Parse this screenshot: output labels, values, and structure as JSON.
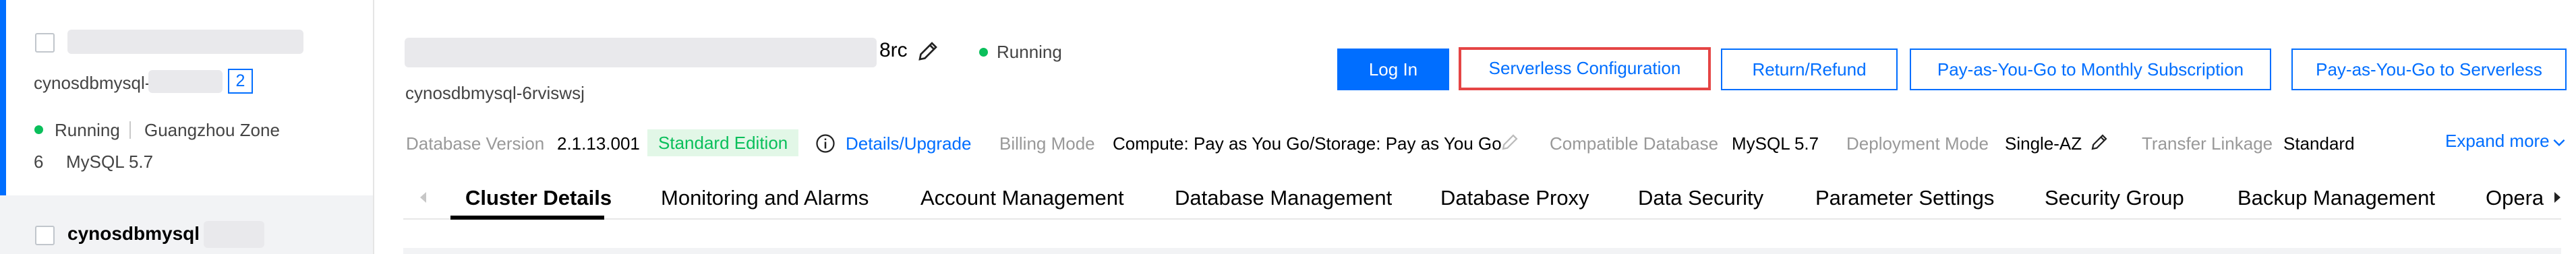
{
  "sidebar": {
    "selected_item": {
      "instance_id": "cynosdbmysql-",
      "count_badge": "2",
      "status": "Running",
      "zone": "Guangzhou Zone",
      "zone_number": "6",
      "engine": "MySQL 5.7"
    },
    "next_item": {
      "instance_id": "cynosdbmysql"
    }
  },
  "header": {
    "cluster_name_suffix": "8rc",
    "status": "Running",
    "cluster_id": "cynosdbmysql-6rviswsj",
    "buttons": {
      "login": "Log In",
      "serverless_config": "Serverless Configuration",
      "return_refund": "Return/Refund",
      "monthly": "Pay-as-You-Go to Monthly Subscription",
      "serverless": "Pay-as-You-Go to Serverless"
    }
  },
  "info": {
    "db_version_label": "Database Version",
    "db_version_value": "2.1.13.001",
    "edition": "Standard Edition",
    "details_link": "Details/Upgrade",
    "billing_label": "Billing Mode",
    "billing_value": "Compute: Pay as You Go/Storage: Pay as You Go",
    "compat_label": "Compatible Database",
    "compat_value": "MySQL 5.7",
    "deploy_label": "Deployment Mode",
    "deploy_value": "Single-AZ",
    "transfer_label": "Transfer Linkage",
    "transfer_value": "Standard",
    "expand_more": "Expand more"
  },
  "tabs": [
    {
      "label": "Cluster Details",
      "active": true
    },
    {
      "label": "Monitoring and Alarms"
    },
    {
      "label": "Account Management"
    },
    {
      "label": "Database Management"
    },
    {
      "label": "Database Proxy"
    },
    {
      "label": "Data Security"
    },
    {
      "label": "Parameter Settings"
    },
    {
      "label": "Security Group"
    },
    {
      "label": "Backup Management"
    },
    {
      "label": "Opera"
    }
  ],
  "colors": {
    "accent": "#006eff",
    "running": "#0abf5b",
    "highlight_outline": "#e54545"
  },
  "icons": [
    "edit-pencil-icon",
    "info-icon",
    "chevron-down-icon",
    "tab-scroll-left-icon",
    "tab-scroll-right-icon"
  ]
}
